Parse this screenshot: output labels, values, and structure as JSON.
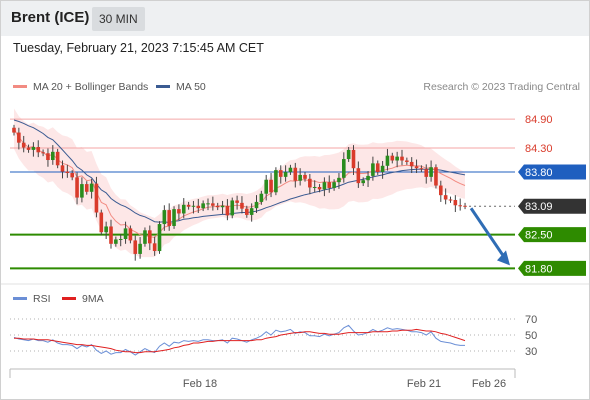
{
  "header": {
    "instrument": "Brent (ICE)",
    "timeframe": "30 MIN"
  },
  "timestamp": "Tuesday, February 21, 2023 7:15:45 AM CET",
  "colors": {
    "ma20": "#f28b82",
    "ma50": "#3b5b92",
    "support": "#2e8b00",
    "resistance": "#f4a6a6",
    "pivot": "#1f5fbf",
    "price_tag": "#333333",
    "bands_fill": "#fde3e3",
    "rsi": "#6b8fd6",
    "rsi_ma": "#e02020",
    "arrow": "#2f6db5"
  },
  "chart_data": [
    {
      "type": "candlestick",
      "legend": [
        {
          "name": "MA 20 + Bollinger Bands",
          "color": "#f28b82"
        },
        {
          "name": "MA 50",
          "color": "#3b5b92"
        }
      ],
      "credit": "Research © 2023 Trading Central",
      "ylim": [
        81.6,
        85.4
      ],
      "levels": [
        {
          "value": 84.9,
          "label": "84.90",
          "kind": "resistance"
        },
        {
          "value": 84.3,
          "label": "84.30",
          "kind": "resistance"
        },
        {
          "value": 83.8,
          "label": "83.80",
          "kind": "pivot"
        },
        {
          "value": 83.09,
          "label": "83.09",
          "kind": "last"
        },
        {
          "value": 82.5,
          "label": "82.50",
          "kind": "support"
        },
        {
          "value": 81.8,
          "label": "81.80",
          "kind": "support"
        }
      ],
      "x_ticks": [
        "Feb 18",
        "Feb 21",
        "Feb 26"
      ],
      "closes": [
        84.62,
        84.41,
        84.31,
        84.26,
        84.32,
        84.21,
        84.19,
        84.05,
        84.22,
        83.94,
        83.81,
        83.78,
        83.69,
        83.27,
        83.55,
        83.39,
        83.56,
        82.96,
        82.55,
        82.67,
        82.31,
        82.4,
        82.41,
        82.63,
        82.38,
        82.1,
        82.31,
        82.59,
        82.32,
        82.16,
        82.72,
        83.01,
        82.68,
        83.03,
        82.94,
        83.12,
        83.08,
        83.1,
        83.05,
        83.15,
        83.15,
        83.1,
        83.07,
        83.1,
        82.9,
        83.21,
        83.16,
        83.04,
        82.91,
        83.05,
        83.18,
        83.35,
        83.64,
        83.38,
        83.84,
        83.7,
        83.8,
        83.89,
        83.62,
        83.74,
        83.66,
        83.48,
        83.49,
        83.44,
        83.59,
        83.47,
        83.59,
        83.68,
        84.07,
        84.26,
        83.88,
        83.57,
        83.63,
        83.72,
        83.98,
        83.8,
        83.93,
        84.14,
        84.04,
        84.12,
        84.04,
        84.01,
        83.92,
        83.88,
        83.86,
        83.7,
        83.9,
        83.52,
        83.32,
        83.23,
        83.22,
        83.11,
        83.1,
        83.09
      ],
      "ma20": [
        84.7,
        84.52,
        84.4,
        84.31,
        84.33,
        84.25,
        84.21,
        84.13,
        84.17,
        84.06,
        83.98,
        83.95,
        83.89,
        83.7,
        83.72,
        83.62,
        83.64,
        83.38,
        83.17,
        83.12,
        82.9,
        82.78,
        82.7,
        82.71,
        82.61,
        82.56,
        82.5,
        82.48,
        82.46,
        82.44,
        82.54,
        82.66,
        82.68,
        82.78,
        82.82,
        82.89,
        82.93,
        82.97,
        83.0,
        83.04,
        83.07,
        83.08,
        83.09,
        83.11,
        83.08,
        83.1,
        83.11,
        83.1,
        83.07,
        83.08,
        83.11,
        83.17,
        83.3,
        83.36,
        83.46,
        83.51,
        83.57,
        83.62,
        83.61,
        83.64,
        83.64,
        83.62,
        83.61,
        83.58,
        83.6,
        83.59,
        83.6,
        83.62,
        83.68,
        83.78,
        83.8,
        83.77,
        83.77,
        83.78,
        83.83,
        83.82,
        83.83,
        83.86,
        83.88,
        83.92,
        83.93,
        83.94,
        83.93,
        83.93,
        83.92,
        83.88,
        83.89,
        83.83,
        83.77,
        83.72,
        83.67,
        83.61,
        83.56,
        83.52
      ],
      "ma50": [
        84.88,
        84.85,
        84.81,
        84.76,
        84.72,
        84.66,
        84.6,
        84.52,
        84.47,
        84.37,
        84.26,
        84.15,
        84.04,
        83.91,
        83.84,
        83.74,
        83.68,
        83.55,
        83.43,
        83.37,
        83.25,
        83.18,
        83.12,
        83.08,
        83.02,
        82.95,
        82.9,
        82.87,
        82.82,
        82.77,
        82.76,
        82.77,
        82.75,
        82.78,
        82.79,
        82.82,
        82.83,
        82.85,
        82.86,
        82.88,
        82.89,
        82.9,
        82.91,
        82.92,
        82.92,
        82.94,
        82.95,
        82.96,
        82.96,
        82.97,
        82.99,
        83.02,
        83.06,
        83.09,
        83.13,
        83.17,
        83.2,
        83.24,
        83.27,
        83.3,
        83.33,
        83.35,
        83.38,
        83.4,
        83.43,
        83.45,
        83.48,
        83.51,
        83.55,
        83.59,
        83.61,
        83.63,
        83.65,
        83.67,
        83.7,
        83.72,
        83.74,
        83.77,
        83.79,
        83.81,
        83.83,
        83.84,
        83.85,
        83.86,
        83.86,
        83.86,
        83.86,
        83.85,
        83.84,
        83.82,
        83.8,
        83.78,
        83.76,
        83.74
      ],
      "forecast": {
        "from": 83.09,
        "to": 81.8
      }
    },
    {
      "type": "line",
      "legend": [
        {
          "name": "RSI",
          "color": "#6b8fd6"
        },
        {
          "name": "9MA",
          "color": "#e02020"
        }
      ],
      "y_ticks": [
        70,
        50,
        30
      ],
      "ylim": [
        10,
        80
      ],
      "rsi": [
        47,
        45,
        44,
        43,
        45,
        43,
        43,
        41,
        44,
        40,
        38,
        38,
        37,
        33,
        37,
        35,
        38,
        31,
        27,
        30,
        26,
        28,
        28,
        32,
        29,
        25,
        29,
        33,
        30,
        28,
        36,
        40,
        36,
        41,
        40,
        43,
        42,
        43,
        42,
        44,
        44,
        43,
        43,
        44,
        40,
        46,
        45,
        43,
        41,
        44,
        46,
        49,
        54,
        50,
        56,
        54,
        55,
        57,
        52,
        54,
        53,
        49,
        49,
        48,
        51,
        49,
        51,
        53,
        59,
        62,
        55,
        50,
        51,
        53,
        57,
        54,
        56,
        59,
        57,
        58,
        57,
        56,
        54,
        54,
        53,
        50,
        54,
        46,
        42,
        41,
        40,
        38,
        37,
        37
      ],
      "ma9": [
        46,
        46,
        45,
        45,
        45,
        44,
        44,
        44,
        43,
        42,
        41,
        40,
        39,
        38,
        38,
        37,
        37,
        36,
        35,
        34,
        33,
        31,
        30,
        29,
        29,
        28,
        28,
        29,
        29,
        29,
        30,
        31,
        32,
        34,
        35,
        37,
        38,
        40,
        40,
        41,
        42,
        42,
        43,
        43,
        43,
        43,
        43,
        43,
        43,
        43,
        44,
        44,
        46,
        47,
        48,
        50,
        51,
        52,
        53,
        53,
        54,
        54,
        53,
        52,
        52,
        51,
        51,
        51,
        52,
        53,
        53,
        53,
        53,
        53,
        54,
        54,
        54,
        54,
        55,
        55,
        56,
        56,
        56,
        57,
        56,
        55,
        55,
        54,
        52,
        51,
        49,
        47,
        45,
        43
      ]
    }
  ]
}
